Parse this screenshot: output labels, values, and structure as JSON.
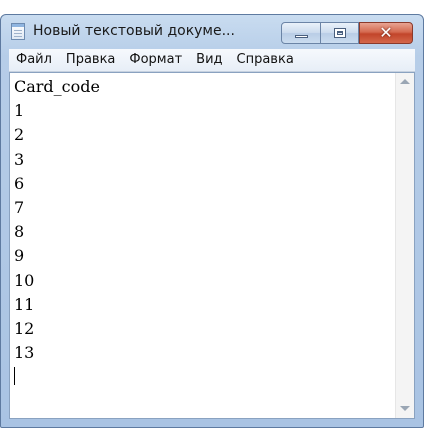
{
  "window": {
    "title": "Новый текстовый докуме...",
    "close_glyph": "✕"
  },
  "menu": {
    "items": [
      "Файл",
      "Правка",
      "Формат",
      "Вид",
      "Справка"
    ]
  },
  "editor": {
    "lines": [
      "Card_code",
      "1",
      "2",
      "3",
      "6",
      "7",
      "8",
      "9",
      "10",
      "11",
      "12",
      "13",
      ""
    ]
  },
  "icons": {
    "app": "notepad-icon",
    "minimize": "minimize-icon",
    "maximize": "maximize-icon",
    "close": "close-icon",
    "scroll_up": "scroll-up-arrow-icon",
    "scroll_down": "scroll-down-arrow-icon"
  },
  "colors": {
    "title_bar": "#b6cde8",
    "close_button": "#c2452a",
    "editor_background": "#ffffff"
  }
}
